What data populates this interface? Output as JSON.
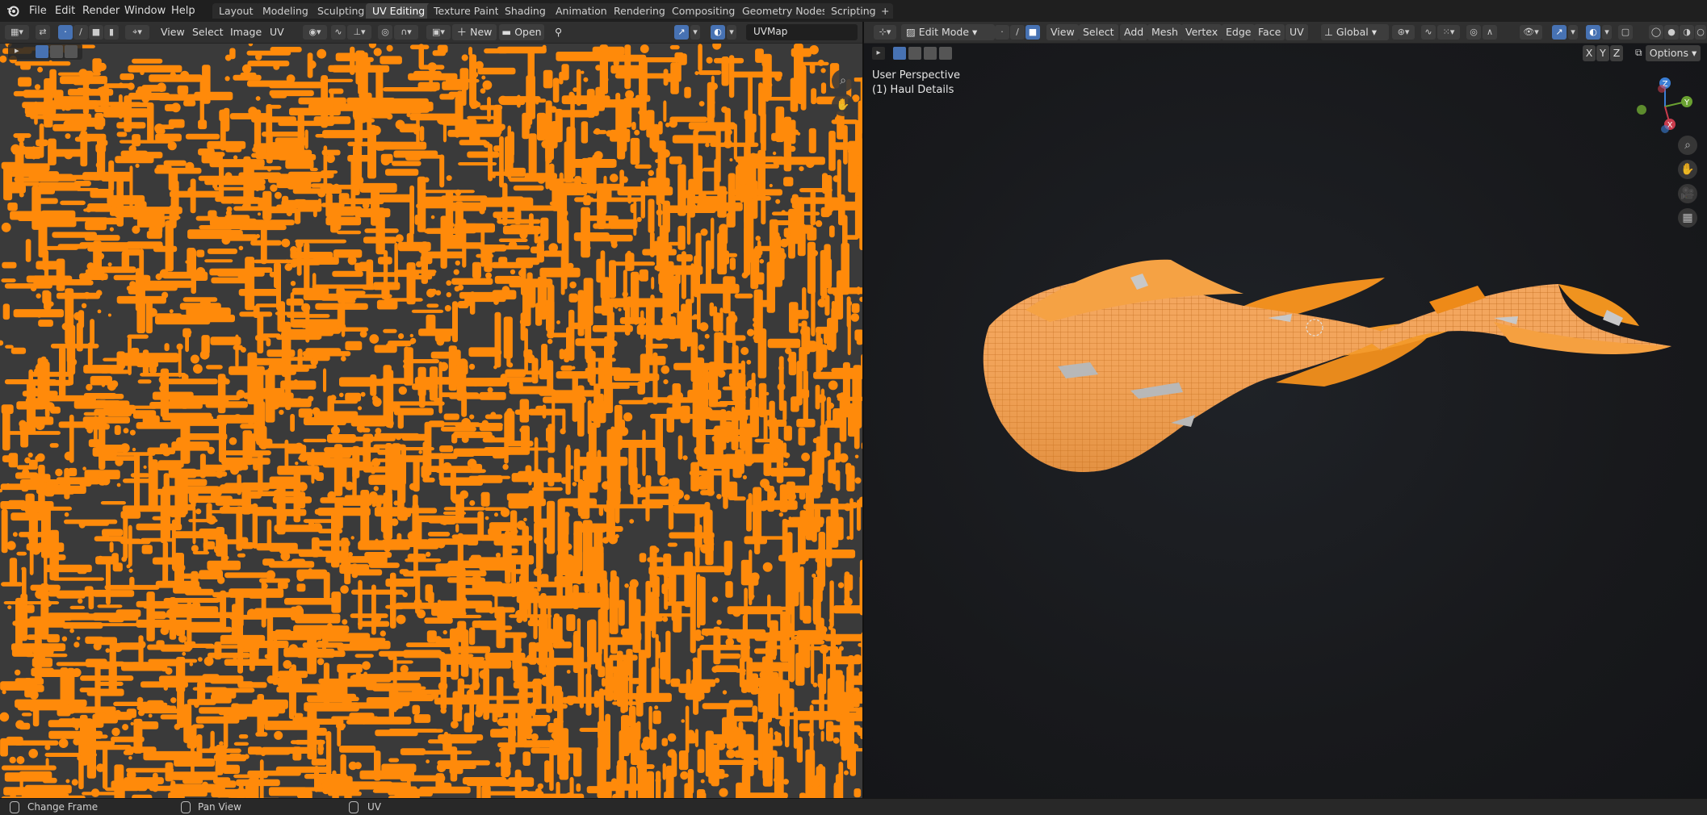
{
  "topbar": {
    "menus": [
      "File",
      "Edit",
      "Render",
      "Window",
      "Help"
    ],
    "workspace_tabs": [
      "Layout",
      "Modeling",
      "Sculpting",
      "UV Editing",
      "Texture Paint",
      "Shading",
      "Animation",
      "Rendering",
      "Compositing",
      "Geometry Nodes",
      "Scripting"
    ],
    "active_tab": "UV Editing",
    "add_tab_label": "+"
  },
  "uv_editor": {
    "menus": [
      "View",
      "Select",
      "Image",
      "UV"
    ],
    "new_label": "New",
    "open_label": "Open",
    "uvmap_value": "UVMap",
    "island_color": "#ff8a0a",
    "bg_color": "#3a3a3a"
  },
  "viewport": {
    "mode_label": "Edit Mode",
    "menus": [
      "View",
      "Select",
      "Add",
      "Mesh",
      "Vertex",
      "Edge",
      "Face",
      "UV"
    ],
    "transform_orientation": "Global",
    "axis_buttons": [
      "X",
      "Y",
      "Z"
    ],
    "options_label": "Options",
    "perspective_label": "User Perspective",
    "object_label": "(1) Haul Details",
    "gizmo": {
      "z": "Z",
      "y": "Y",
      "x": "X"
    },
    "mesh_color": "#f0a050"
  },
  "statusbar": {
    "items": [
      "Change Frame",
      "Pan View",
      "UV"
    ]
  },
  "colors": {
    "accent": "#4772b3",
    "orange": "#ff8a0a"
  }
}
